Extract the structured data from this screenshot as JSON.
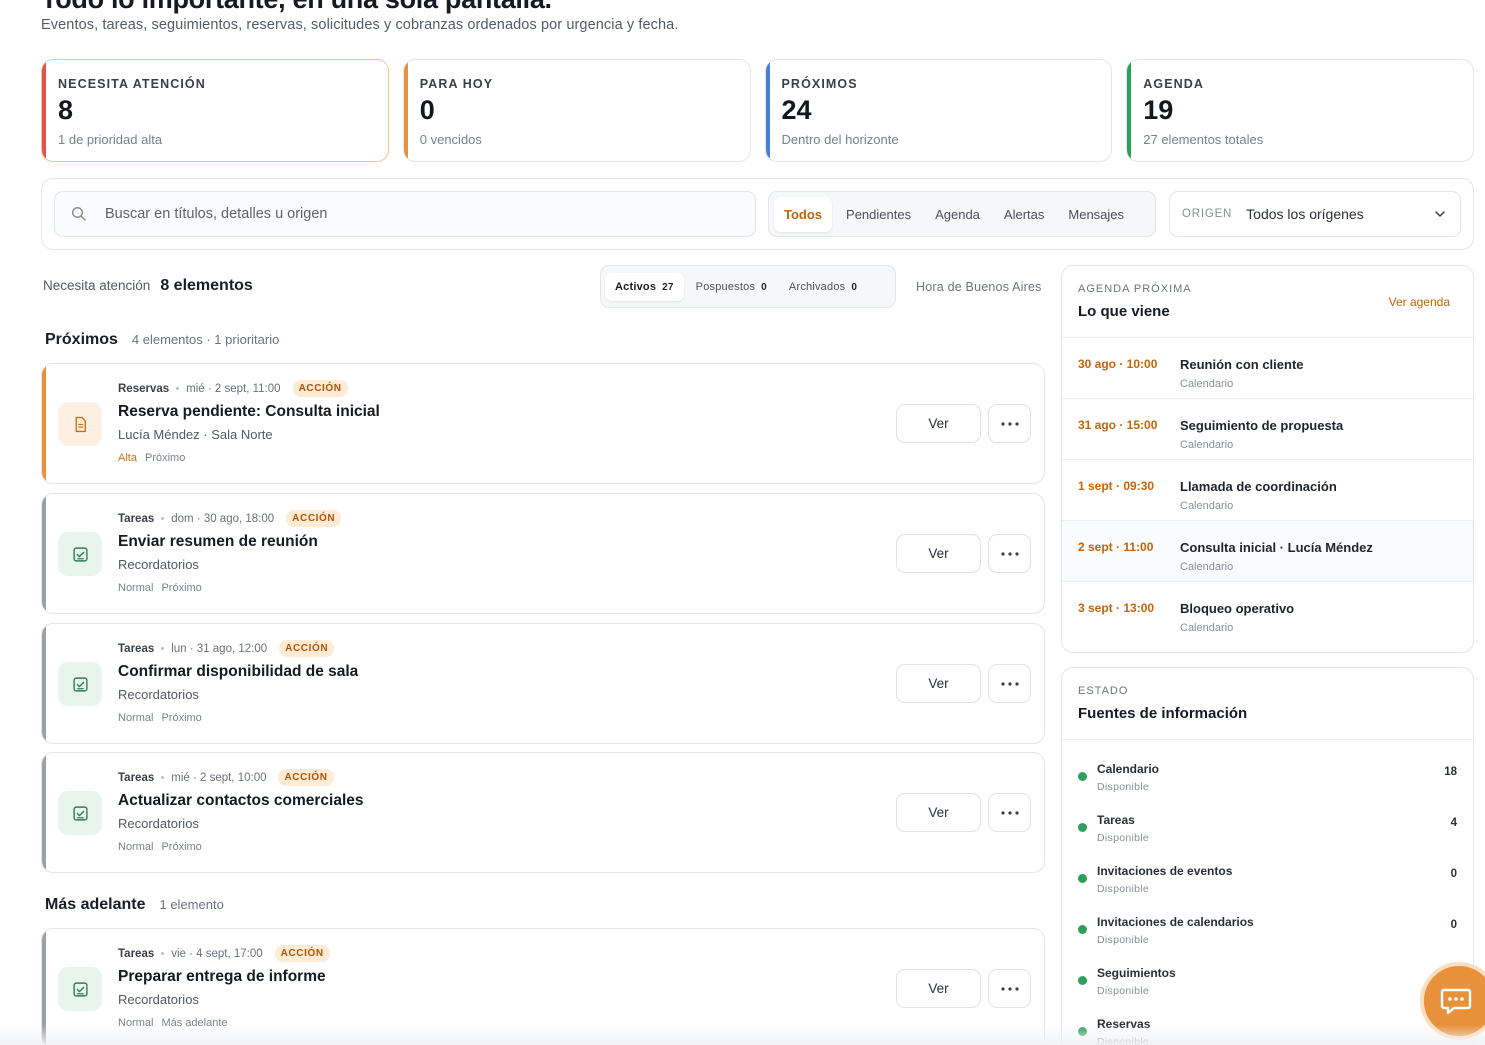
{
  "header": {
    "title": "Todo lo importante, en una sola pantalla.",
    "subtitle": "Eventos, tareas, seguimientos, reservas, solicitudes y cobranzas ordenados por urgencia y fecha."
  },
  "stats": [
    {
      "label": "NECESITA ATENCIÓN",
      "value": "8",
      "sub": "1 de prioridad alta",
      "accent": "#e05252"
    },
    {
      "label": "PARA HOY",
      "value": "0",
      "sub": "0 vencidos",
      "accent": "#e8913a"
    },
    {
      "label": "PRÓXIMOS",
      "value": "24",
      "sub": "Dentro del horizonte",
      "accent": "#4a7fd1"
    },
    {
      "label": "AGENDA",
      "value": "19",
      "sub": "27 elementos totales",
      "accent": "#2e9e5b"
    }
  ],
  "filters": {
    "search_placeholder": "Buscar en títulos, detalles u origen",
    "tabs": [
      "Todos",
      "Pendientes",
      "Agenda",
      "Alertas",
      "Mensajes"
    ],
    "origin_label": "ORIGEN",
    "origin_value": "Todos los orígenes"
  },
  "toolbar": {
    "label": "Necesita atención",
    "count": "8 elementos",
    "status_tabs": [
      {
        "label": "Activos",
        "count": "27"
      },
      {
        "label": "Pospuestos",
        "count": "0"
      },
      {
        "label": "Archivados",
        "count": "0"
      }
    ],
    "timezone": "Hora de Buenos Aires"
  },
  "groups": [
    {
      "title": "Próximos",
      "meta": "4 elementos · 1 prioritario",
      "items": [
        {
          "source": "Reservas",
          "when": "mié · 2 sept, 11:00",
          "badge": "ACCIÓN",
          "title": "Reserva pendiente: Consulta inicial",
          "desc": "Lucía Méndez · Sala Norte",
          "priority": "Alta",
          "status": "Próximo",
          "view": "Ver",
          "icon": "document-icon",
          "bar": "#e8913a"
        },
        {
          "source": "Tareas",
          "when": "dom · 30 ago, 18:00",
          "badge": "ACCIÓN",
          "title": "Enviar resumen de reunión",
          "desc": "Recordatorios",
          "priority": "Normal",
          "status": "Próximo",
          "view": "Ver",
          "icon": "task-icon",
          "bar": "#9aa0aa"
        },
        {
          "source": "Tareas",
          "when": "lun · 31 ago, 12:00",
          "badge": "ACCIÓN",
          "title": "Confirmar disponibilidad de sala",
          "desc": "Recordatorios",
          "priority": "Normal",
          "status": "Próximo",
          "view": "Ver",
          "icon": "task-icon",
          "bar": "#9aa0aa"
        },
        {
          "source": "Tareas",
          "when": "mié · 2 sept, 10:00",
          "badge": "ACCIÓN",
          "title": "Actualizar contactos comerciales",
          "desc": "Recordatorios",
          "priority": "Normal",
          "status": "Próximo",
          "view": "Ver",
          "icon": "task-icon",
          "bar": "#9aa0aa"
        }
      ]
    },
    {
      "title": "Más adelante",
      "meta": "1 elemento",
      "items": [
        {
          "source": "Tareas",
          "when": "vie · 4 sept, 17:00",
          "badge": "ACCIÓN",
          "title": "Preparar entrega de informe",
          "desc": "Recordatorios",
          "priority": "Normal",
          "status": "Más adelante",
          "view": "Ver",
          "icon": "task-icon",
          "bar": "#9aa0aa"
        }
      ]
    }
  ],
  "agenda": {
    "eyebrow": "AGENDA PRÓXIMA",
    "title": "Lo que viene",
    "link": "Ver agenda",
    "items": [
      {
        "time": "30 ago · 10:00",
        "title": "Reunión con cliente",
        "sub": "Calendario"
      },
      {
        "time": "31 ago · 15:00",
        "title": "Seguimiento de propuesta",
        "sub": "Calendario"
      },
      {
        "time": "1 sept · 09:30",
        "title": "Llamada de coordinación",
        "sub": "Calendario"
      },
      {
        "time": "2 sept · 11:00",
        "title": "Consulta inicial · Lucía Méndez",
        "sub": "Calendario"
      },
      {
        "time": "3 sept · 13:00",
        "title": "Bloqueo operativo",
        "sub": "Calendario"
      }
    ]
  },
  "sources": {
    "eyebrow": "ESTADO",
    "title": "Fuentes de información",
    "items": [
      {
        "name": "Calendario",
        "status": "Disponible",
        "count": "18"
      },
      {
        "name": "Tareas",
        "status": "Disponible",
        "count": "4"
      },
      {
        "name": "Invitaciones de eventos",
        "status": "Disponible",
        "count": "0"
      },
      {
        "name": "Invitaciones de calendarios",
        "status": "Disponible",
        "count": "0"
      },
      {
        "name": "Seguimientos",
        "status": "Disponible",
        "count": ""
      },
      {
        "name": "Reservas",
        "status": "Disponible",
        "count": ""
      }
    ]
  }
}
